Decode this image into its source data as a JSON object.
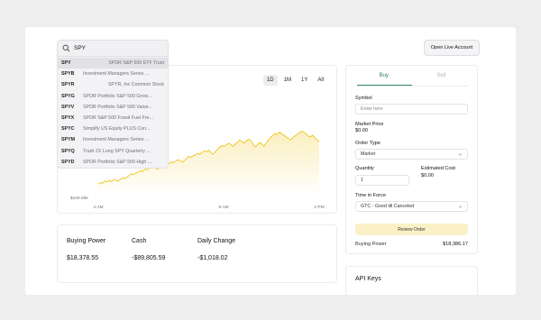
{
  "search": {
    "query": "SPY",
    "results": [
      {
        "symbol": "SPY",
        "name": "SPDR S&P 500 ETF Trust",
        "align": "right",
        "active": true
      },
      {
        "symbol": "SPYB",
        "name": "Investment Managers Series ...",
        "align": "left",
        "active": false
      },
      {
        "symbol": "SPYR",
        "name": "SPYR, Inc Common Stock",
        "align": "right",
        "active": false
      },
      {
        "symbol": "SPYG",
        "name": "SPDR Portfolio S&P 500 Grow...",
        "align": "left",
        "active": false
      },
      {
        "symbol": "SPYV",
        "name": "SPDR Portfolio S&P 500 Value...",
        "align": "left",
        "active": false
      },
      {
        "symbol": "SPYX",
        "name": "SPDR S&P 500 Fossil Fuel Fre...",
        "align": "left",
        "active": false
      },
      {
        "symbol": "SPYC",
        "name": "Simplify US Equity PLUS Con...",
        "align": "left",
        "active": false
      },
      {
        "symbol": "SPYM",
        "name": "Investment Managers Series ...",
        "align": "left",
        "active": false
      },
      {
        "symbol": "SPYQ",
        "name": "Tradr 2X Long SPY Quarterly ...",
        "align": "left",
        "active": false
      },
      {
        "symbol": "SPYD",
        "name": "SPDR Portfolio S&P 500 High ...",
        "align": "left",
        "active": false
      }
    ]
  },
  "header": {
    "open_live_account": "Open Live Account"
  },
  "chart": {
    "range_tabs": [
      "1D",
      "1M",
      "1Y",
      "All"
    ],
    "active_range": "1D",
    "y_min_label": "$106.59k",
    "x_labels": [
      "4 AM",
      "8 AM",
      "2 PM"
    ],
    "line_color": "#f0c419"
  },
  "chart_data": {
    "type": "area",
    "x": [
      "4 AM",
      "8 AM",
      "2 PM"
    ],
    "ylabel": "",
    "series": [
      {
        "values": [
          0.1,
          0.12,
          0.11,
          0.14,
          0.13,
          0.15,
          0.13,
          0.16,
          0.15,
          0.14,
          0.16,
          0.18,
          0.17,
          0.19,
          0.21,
          0.23,
          0.22,
          0.24,
          0.25,
          0.27,
          0.26,
          0.29,
          0.28,
          0.3,
          0.32,
          0.31,
          0.3,
          0.29,
          0.31,
          0.33,
          0.35,
          0.34,
          0.36,
          0.38,
          0.37,
          0.39,
          0.41,
          0.4,
          0.38,
          0.4,
          0.43,
          0.45,
          0.44,
          0.46,
          0.47,
          0.49,
          0.48,
          0.5,
          0.52,
          0.51,
          0.53,
          0.5,
          0.48,
          0.51,
          0.54,
          0.57,
          0.59,
          0.58,
          0.6,
          0.62,
          0.6,
          0.58,
          0.61,
          0.63,
          0.66,
          0.64,
          0.62,
          0.65,
          0.67,
          0.65,
          0.61,
          0.57,
          0.6,
          0.63,
          0.61,
          0.58,
          0.62,
          0.66,
          0.69,
          0.72,
          0.74,
          0.73,
          0.76,
          0.74,
          0.72,
          0.7,
          0.68,
          0.66,
          0.69,
          0.71,
          0.73,
          0.75,
          0.77,
          0.76,
          0.74,
          0.71,
          0.7,
          0.72,
          0.69,
          0.66,
          0.64
        ]
      }
    ]
  },
  "balances": [
    {
      "label": "Buying Power",
      "value": "$18,378.55"
    },
    {
      "label": "Cash",
      "value": "-$89,805.59"
    },
    {
      "label": "Daily Change",
      "value": "-$1,018.02"
    }
  ],
  "order": {
    "tabs": [
      "Buy",
      "Sell"
    ],
    "active_tab": "Buy",
    "symbol_label": "Symbol",
    "symbol_placeholder": "Enter here",
    "market_price_label": "Market Price",
    "market_price_value": "$0.00",
    "order_type_label": "Order Type",
    "order_type_value": "Market",
    "quantity_label": "Quantity",
    "quantity_value": "1",
    "estimated_cost_label": "Estimated Cost",
    "estimated_cost_value": "$0.00",
    "time_in_force_label": "Time in Force",
    "time_in_force_value": "GTC - Good till Canceled",
    "review_button": "Review Order",
    "buying_power_label": "Buying Power",
    "buying_power_value": "$18,386.17"
  },
  "api_keys": {
    "title": "API Keys"
  },
  "colors": {
    "accent_green": "#2f8f6a",
    "chart_gold": "#f0c419",
    "review_bg": "#fbf1c7"
  }
}
